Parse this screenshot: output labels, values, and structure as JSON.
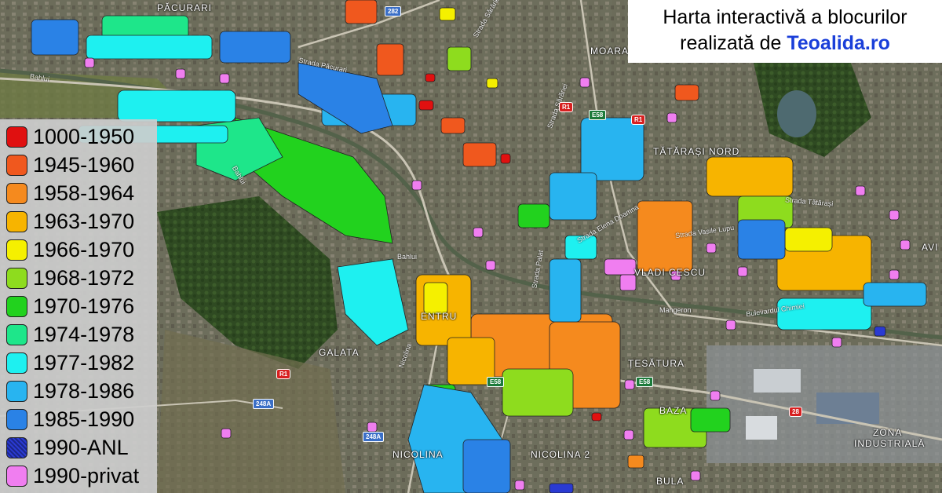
{
  "title": {
    "line1": "Harta interactivă a blocurilor",
    "line2_prefix": "realizată de ",
    "brand": "Teoalida.ro"
  },
  "legend": [
    {
      "label": "1000-1950",
      "color": "#e01010"
    },
    {
      "label": "1945-1960",
      "color": "#f0581e"
    },
    {
      "label": "1958-1964",
      "color": "#f58a1e"
    },
    {
      "label": "1963-1970",
      "color": "#f7b400"
    },
    {
      "label": "1966-1970",
      "color": "#f5f000"
    },
    {
      "label": "1968-1972",
      "color": "#8edc1e"
    },
    {
      "label": "1970-1976",
      "color": "#22d21e"
    },
    {
      "label": "1974-1978",
      "color": "#1ee68a"
    },
    {
      "label": "1977-1982",
      "color": "#1ef0f0"
    },
    {
      "label": "1978-1986",
      "color": "#28b4f0"
    },
    {
      "label": "1985-1990",
      "color": "#2a82e6"
    },
    {
      "label": "1990-ANL",
      "color": "#2a3ad2"
    },
    {
      "label": "1990-privat",
      "color": "#f07ef0"
    }
  ],
  "places": {
    "pacurari": "PĂCURARI",
    "moara_de_vant": "MOARA DE VÂ",
    "tatarasi_nord": "TĂTĂRAȘI NORD",
    "vladiceasca": "VLADI CESCU",
    "galata": "GALATA",
    "tesatura": "ȚESĂTURA",
    "nicolina1": "NICOLINA",
    "nicolina2": "NICOLINA 2",
    "zona_industriala_1": "ZONA",
    "zona_industriala_2": "INDUSTRIALĂ",
    "bularga": "BULA",
    "baza": "BAZA",
    "centru": "ENTRU",
    "avi": "AVI",
    "bahlui_1": "Bahlui",
    "bahlui_2": "Bahlui",
    "bahlui_3": "Bahlui"
  },
  "streets": {
    "strada_sararie": "Strada Sărăriei",
    "strada_sararie_2": "Strada Sărăriei",
    "strada_pacurari": "Strada Păcurari",
    "strada_tatarasi": "Strada Tătărași",
    "vasile_lupu": "Strada Vasile Lupu",
    "elena_doamna": "Strada Elena Doamna",
    "bulevardul_chimiei": "Bulevardul Chimiei",
    "mangeron": "Mangeron",
    "palat": "Strada Palat",
    "nicolina_str": "Nicolina",
    "calea_chisinaului": "Calea Chișinăului"
  },
  "shields": {
    "r282": "282",
    "e58_1": "E58",
    "e58_2": "E58",
    "e58_3": "E58",
    "r248a_1": "248A",
    "r248a_2": "248A",
    "r28": "28",
    "r1_1": "R1",
    "r1_2": "R1",
    "r1_3": "R1"
  }
}
